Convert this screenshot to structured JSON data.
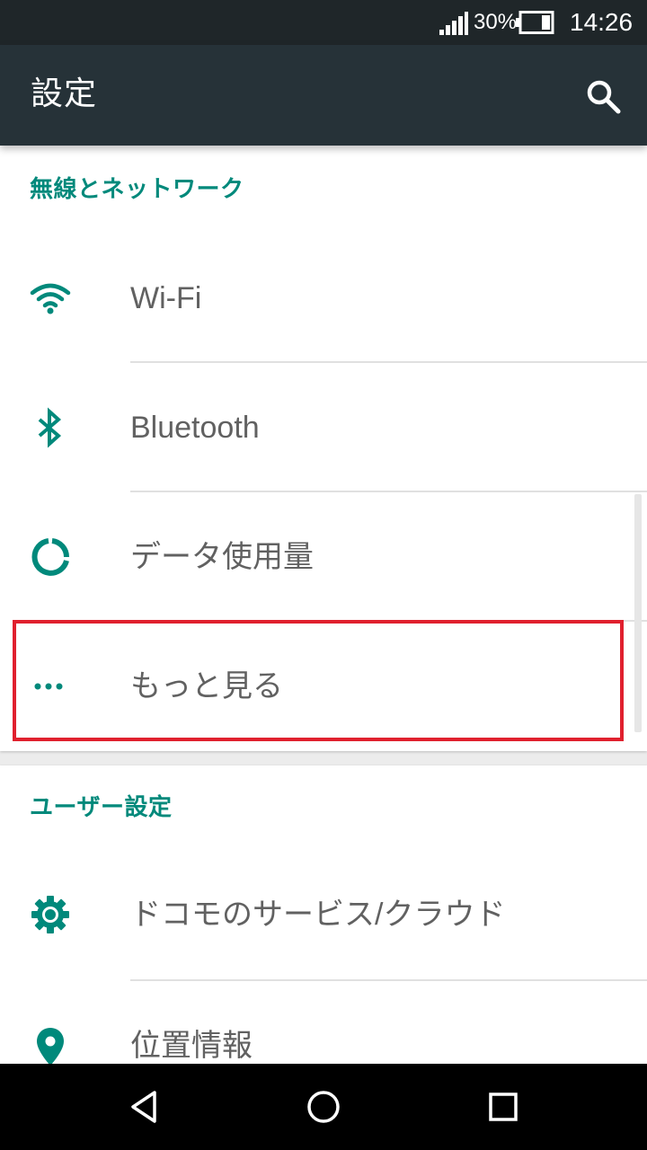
{
  "status_bar": {
    "battery_percent": "30%",
    "time": "14:26",
    "icons": [
      "signal-icon",
      "battery-icon"
    ]
  },
  "toolbar": {
    "title": "設定",
    "search_icon": "search-icon"
  },
  "sections": [
    {
      "header": "無線とネットワーク",
      "items": [
        {
          "label": "Wi-Fi",
          "icon": "wifi-icon"
        },
        {
          "label": "Bluetooth",
          "icon": "bluetooth-icon"
        },
        {
          "label": "データ使用量",
          "icon": "data-usage-icon"
        },
        {
          "label": "もっと見る",
          "icon": "more-icon",
          "highlighted": true
        }
      ]
    },
    {
      "header": "ユーザー設定",
      "items": [
        {
          "label": "ドコモのサービス/クラウド",
          "icon": "gear-icon"
        },
        {
          "label": "位置情報",
          "icon": "location-pin-icon"
        }
      ]
    }
  ],
  "colors": {
    "accent": "#00897b",
    "toolbar": "#263238",
    "status_bar": "#1f2629",
    "highlight_border": "#e0202e"
  },
  "nav_bar": {
    "icons": [
      "back-icon",
      "home-icon",
      "recents-icon"
    ]
  }
}
